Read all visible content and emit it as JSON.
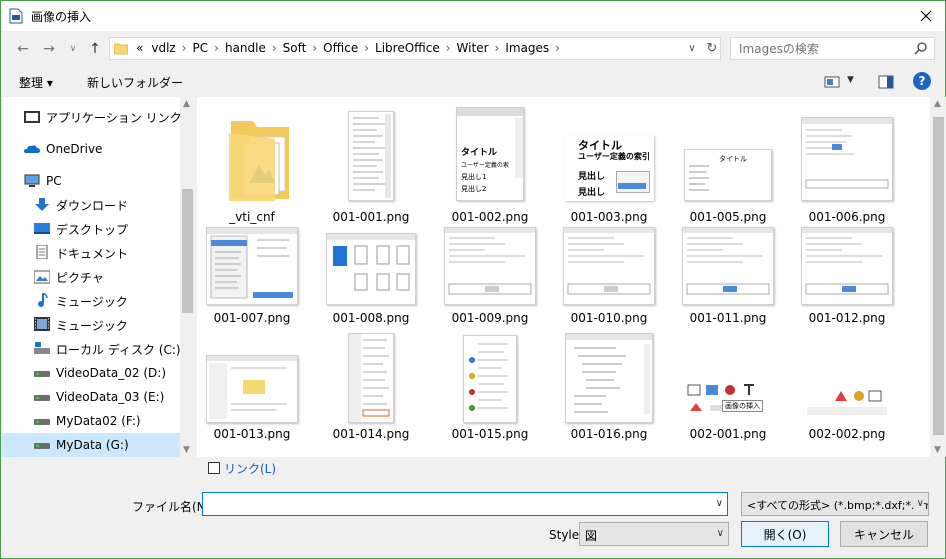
{
  "window": {
    "title": "画像の挿入",
    "close_icon": "close-icon"
  },
  "address": {
    "overflow": "«",
    "crumbs": [
      "vdlz",
      "PC",
      "handle",
      "Soft",
      "Office",
      "LibreOffice",
      "Witer",
      "Images"
    ]
  },
  "search": {
    "placeholder": "Imagesの検索"
  },
  "toolbar": {
    "organize_label": "整理 ▾",
    "new_folder_label": "新しいフォルダー"
  },
  "nav": {
    "items": [
      {
        "label": "アプリケーション リンク",
        "icon": "app-links-icon"
      },
      {
        "label": "OneDrive",
        "icon": "onedrive-icon"
      },
      {
        "label": "PC",
        "icon": "pc-icon"
      },
      {
        "label": "ダウンロード",
        "icon": "download-icon"
      },
      {
        "label": "デスクトップ",
        "icon": "desktop-icon"
      },
      {
        "label": "ドキュメント",
        "icon": "document-icon"
      },
      {
        "label": "ピクチャ",
        "icon": "pictures-icon"
      },
      {
        "label": "ミュージック",
        "icon": "music-icon"
      },
      {
        "label": "ミュージック",
        "icon": "video-icon"
      },
      {
        "label": "ローカル ディスク (C:)",
        "icon": "drive-icon"
      },
      {
        "label": "VideoData_02 (D:)",
        "icon": "drive-icon"
      },
      {
        "label": "VideoData_03 (E:)",
        "icon": "drive-icon"
      },
      {
        "label": "MyData02 (F:)",
        "icon": "drive-icon"
      },
      {
        "label": "MyData (G:)",
        "icon": "drive-icon"
      }
    ],
    "selected": "MyData (G:)"
  },
  "files": {
    "items": [
      "_vti_cnf",
      "001-001.png",
      "001-002.png",
      "001-003.png",
      "001-005.png",
      "001-006.png",
      "001-007.png",
      "001-008.png",
      "001-009.png",
      "001-010.png",
      "001-011.png",
      "001-012.png",
      "001-013.png",
      "001-014.png",
      "001-015.png",
      "001-016.png",
      "002-001.png",
      "002-002.png"
    ],
    "thumb_text": {
      "t003_title": "タイトル",
      "t003_sub": "ユーザー定義の索引",
      "t003_h1": "見出し",
      "t003_h2": "見出し",
      "t002_title": "タイトル",
      "t002_sub": "ユーザー定義の索",
      "t002_h1": "見出し1",
      "t002_h2": "見出し2",
      "t005_title": "タイトル",
      "t017_tip": "画像の挿入"
    }
  },
  "bottom": {
    "link_label": "リンク(L)",
    "filename_label": "ファイル名(N):",
    "filename_value": "",
    "filetype_value": "<すべての形式> (*.bmp;*.dxf;*.emf",
    "style_label": "Style",
    "style_value": "図",
    "open_label": "開く(O)",
    "cancel_label": "キャンセル"
  }
}
